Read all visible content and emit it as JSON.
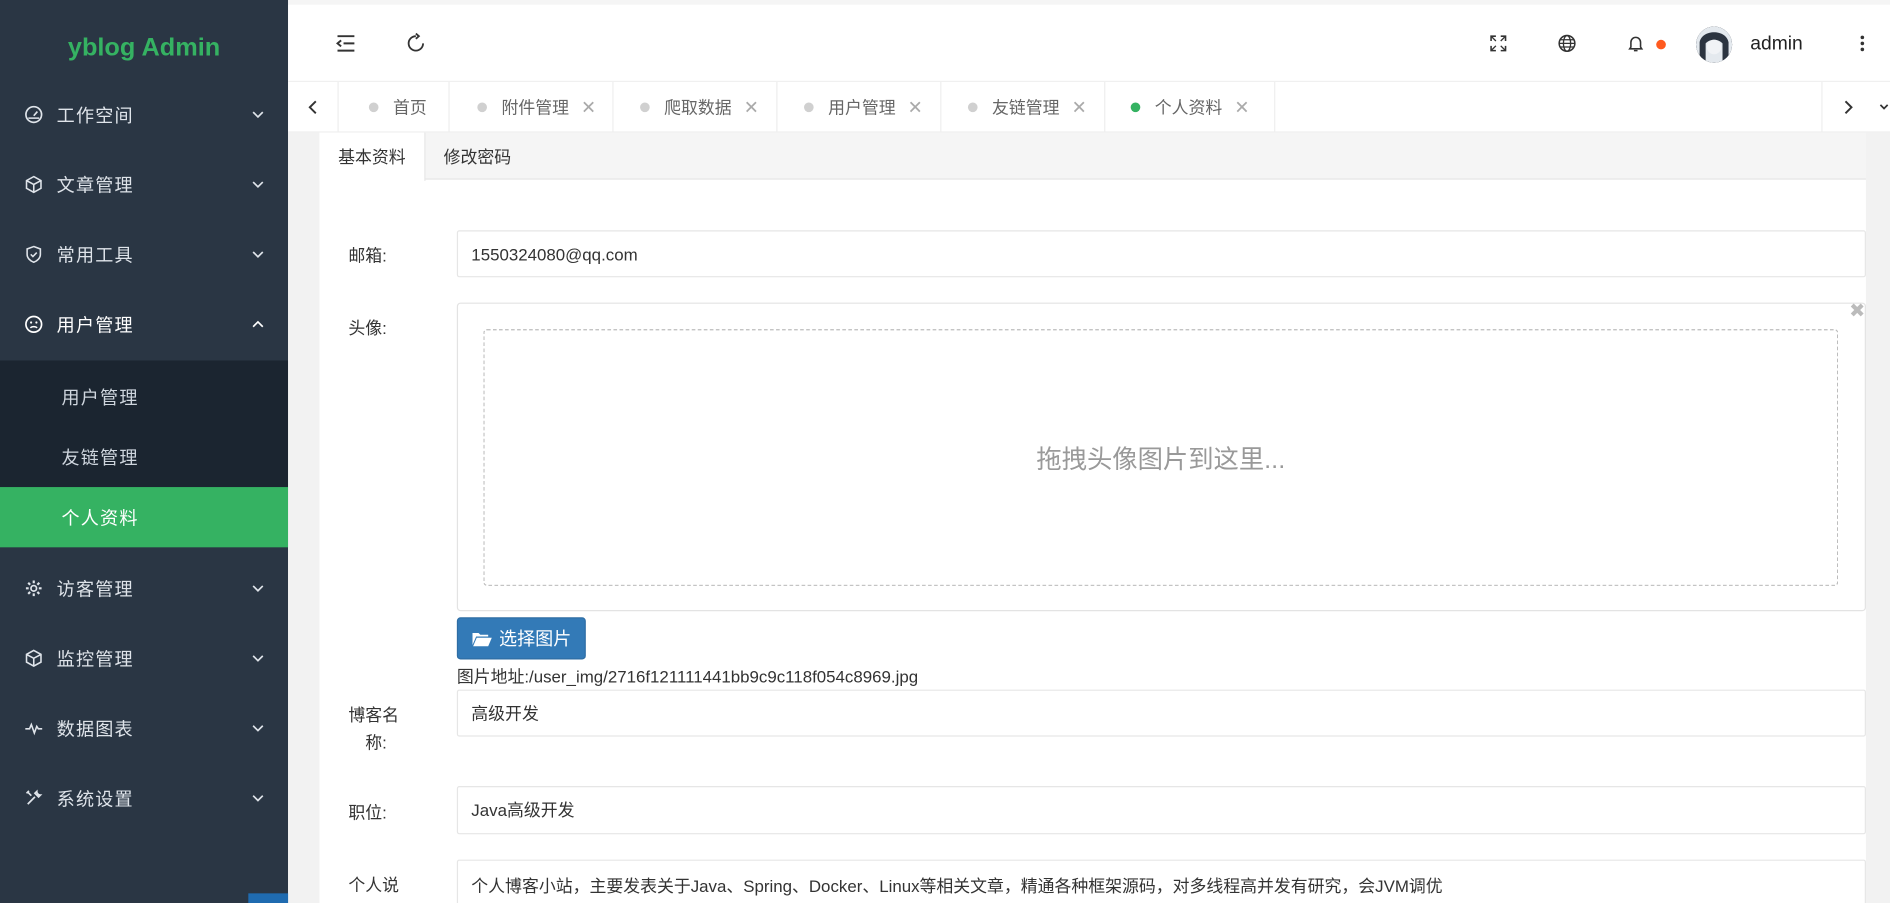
{
  "app": {
    "logo": "yblog Admin"
  },
  "sidebar": {
    "items": [
      {
        "label": "工作空间",
        "icon": "dashboard-icon"
      },
      {
        "label": "文章管理",
        "icon": "cube-icon"
      },
      {
        "label": "常用工具",
        "icon": "shield-check-icon"
      },
      {
        "label": "用户管理",
        "icon": "user-face-icon",
        "expanded": true
      },
      {
        "label": "访客管理",
        "icon": "gear-icon"
      },
      {
        "label": "监控管理",
        "icon": "cube-icon"
      },
      {
        "label": "数据图表",
        "icon": "pulse-icon"
      },
      {
        "label": "系统设置",
        "icon": "tools-icon"
      }
    ],
    "submenu": [
      {
        "label": "用户管理"
      },
      {
        "label": "友链管理"
      },
      {
        "label": "个人资料",
        "active": true
      }
    ]
  },
  "header": {
    "user": "admin"
  },
  "tabs": [
    {
      "label": "首页",
      "closable": false
    },
    {
      "label": "附件管理",
      "closable": true
    },
    {
      "label": "爬取数据",
      "closable": true
    },
    {
      "label": "用户管理",
      "closable": true
    },
    {
      "label": "友链管理",
      "closable": true
    },
    {
      "label": "个人资料",
      "closable": true,
      "active": true
    }
  ],
  "profile": {
    "tabs": [
      "基本资料",
      "修改密码"
    ],
    "email_label": "邮箱:",
    "email_value": "1550324080@qq.com",
    "avatar_label": "头像:",
    "drop_text": "拖拽头像图片到这里...",
    "choose_button": "选择图片",
    "image_path": "图片地址:/user_img/2716f121111441bb9c9c118f054c8969.jpg",
    "blog_name_label_1": "博客名",
    "blog_name_label_2": "称:",
    "blog_name_value": "高级开发",
    "position_label": "职位:",
    "position_value": "Java高级开发",
    "intro_label": "个人说",
    "intro_value": "个人博客小站，主要发表关于Java、Spring、Docker、Linux等相关文章，精通各种框架源码，对多线程高并发有研究，会JVM调优"
  },
  "colors": {
    "sidebar_bg": "#2a3644",
    "submenu_bg": "#1b2530",
    "accent": "#35b262",
    "button_primary": "#337ab7",
    "notification_dot": "#ff5a1f"
  }
}
